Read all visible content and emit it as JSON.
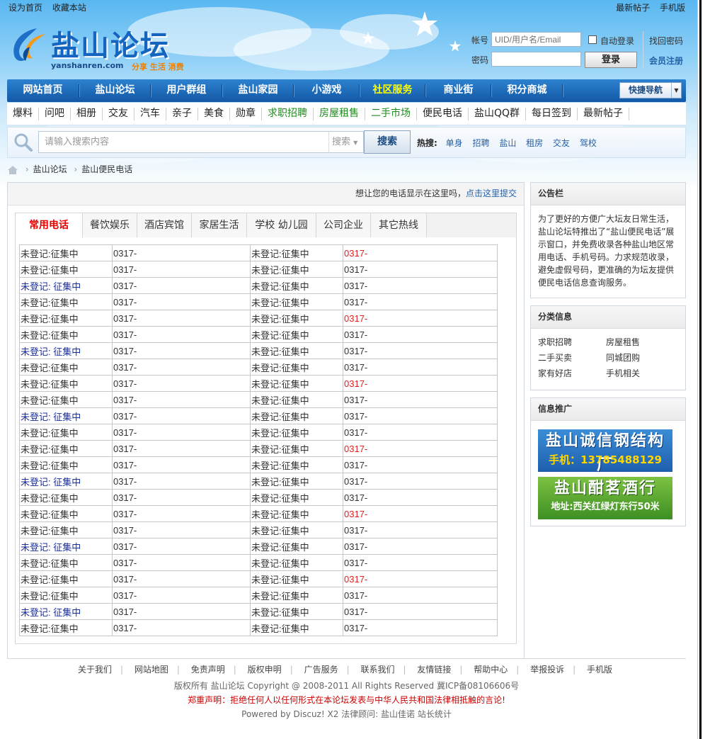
{
  "topbar": {
    "left": [
      "设为首页",
      "收藏本站"
    ],
    "right": [
      "最新帖子",
      "手机版"
    ]
  },
  "logo": {
    "title": "盐山论坛",
    "site": "yanshanren.com",
    "slogan": "分享 生活 消费"
  },
  "login": {
    "account_label": "帐号",
    "account_placeholder": "UID/用户名/Email",
    "password_label": "密码",
    "auto_login": "自动登录",
    "login_button": "登录",
    "find_password": "找回密码",
    "register": "会员注册"
  },
  "nav": {
    "items": [
      "网站首页",
      "盐山论坛",
      "用户群组",
      "盐山家园",
      "小游戏",
      "社区服务",
      "商业街",
      "积分商城"
    ],
    "active_index": 5,
    "quick": "快捷导航",
    "active_color": "#ffff00"
  },
  "subnav": {
    "items": [
      "爆料",
      "问吧",
      "相册",
      "交友",
      "汽车",
      "亲子",
      "美食",
      "勋章",
      "求职招聘",
      "房屋租售",
      "二手市场",
      "便民电话",
      "盐山QQ群",
      "每日签到",
      "最新帖子"
    ],
    "green": [
      "求职招聘",
      "房屋租售",
      "二手市场"
    ]
  },
  "search": {
    "placeholder": "请输入搜索内容",
    "select": "搜索",
    "button": "搜索",
    "hot_label": "热搜:",
    "hot": [
      "单身",
      "招聘",
      "盐山",
      "租房",
      "交友",
      "驾校"
    ]
  },
  "breadcrumb": [
    "盐山论坛",
    "盐山便民电话"
  ],
  "main": {
    "tip_text": "想让您的电话显示在这里吗，",
    "tip_link": "点击这里提交",
    "tabs": [
      "常用电话",
      "餐饮娱乐",
      "酒店宾馆",
      "家居生活",
      "学校 幼儿园",
      "公司企业",
      "其它热线"
    ],
    "active_tab": 0
  },
  "directory": {
    "rows": [
      [
        "未登记:征集中",
        "0317-",
        "未登记:征集中",
        "0317-",
        "n",
        "r"
      ],
      [
        "未登记:征集中",
        "0317-",
        "未登记:征集中",
        "0317-",
        "n",
        "n"
      ],
      [
        "未登记: 征集中",
        "0317-",
        "未登记:征集中",
        "0317-",
        "b",
        "n"
      ],
      [
        "未登记:征集中",
        "0317-",
        "未登记:征集中",
        "0317-",
        "n",
        "n"
      ],
      [
        "未登记:征集中",
        "0317-",
        "未登记:征集中",
        "0317-",
        "n",
        "r"
      ],
      [
        "未登记:征集中",
        "0317-",
        "未登记:征集中",
        "0317-",
        "n",
        "n"
      ],
      [
        "未登记: 征集中",
        "0317-",
        "未登记:征集中",
        "0317-",
        "b",
        "n"
      ],
      [
        "未登记:征集中",
        "0317-",
        "未登记:征集中",
        "0317-",
        "n",
        "n"
      ],
      [
        "未登记:征集中",
        "0317-",
        "未登记:征集中",
        "0317-",
        "n",
        "r"
      ],
      [
        "未登记:征集中",
        "0317-",
        "未登记:征集中",
        "0317-",
        "n",
        "n"
      ],
      [
        "未登记: 征集中",
        "0317-",
        "未登记:征集中",
        "0317-",
        "b",
        "n"
      ],
      [
        "未登记:征集中",
        "0317-",
        "未登记:征集中",
        "0317-",
        "n",
        "n"
      ],
      [
        "未登记:征集中",
        "0317-",
        "未登记:征集中",
        "0317-",
        "n",
        "r"
      ],
      [
        "未登记:征集中",
        "0317-",
        "未登记:征集中",
        "0317-",
        "n",
        "n"
      ],
      [
        "未登记: 征集中",
        "0317-",
        "未登记:征集中",
        "0317-",
        "b",
        "n"
      ],
      [
        "未登记:征集中",
        "0317-",
        "未登记:征集中",
        "0317-",
        "n",
        "n"
      ],
      [
        "未登记:征集中",
        "0317-",
        "未登记:征集中",
        "0317-",
        "n",
        "r"
      ],
      [
        "未登记:征集中",
        "0317-",
        "未登记:征集中",
        "0317-",
        "n",
        "n"
      ],
      [
        "未登记: 征集中",
        "0317-",
        "未登记:征集中",
        "0317-",
        "b",
        "n"
      ],
      [
        "未登记:征集中",
        "0317-",
        "未登记:征集中",
        "0317-",
        "n",
        "n"
      ],
      [
        "未登记:征集中",
        "0317-",
        "未登记:征集中",
        "0317-",
        "n",
        "r"
      ],
      [
        "未登记:征集中",
        "0317-",
        "未登记:征集中",
        "0317-",
        "n",
        "n"
      ],
      [
        "未登记: 征集中",
        "0317-",
        "未登记:征集中",
        "0317-",
        "b",
        "n"
      ],
      [
        "未登记:征集中",
        "0317-",
        "未登记:征集中",
        "0317-",
        "n",
        "n"
      ]
    ]
  },
  "sidebar": {
    "notice_title": "公告栏",
    "notice_text": "为了更好的方便广大坛友日常生活，盐山论坛特推出了“盐山便民电话”展示窗口，并免费收录各种盐山地区常用电话、手机号码。力求规范收录，避免虚假号码，更准确的为坛友提供便民电话信息查询服务。",
    "category_title": "分类信息",
    "categories": [
      [
        "求职招聘",
        "房屋租售"
      ],
      [
        "二手买卖",
        "同城团购"
      ],
      [
        "家有好店",
        "手机相关"
      ]
    ],
    "promo_title": "信息推广",
    "ads": [
      {
        "line1": "盐山诚信钢结构厂",
        "line2": "手机：13785488129"
      },
      {
        "line1": "盐山酣茗酒行",
        "line2": "地址:西关红绿灯东行50米"
      }
    ]
  },
  "footer": {
    "links": [
      "关于我们",
      "网站地图",
      "免责声明",
      "版权申明",
      "广告服务",
      "联系我们",
      "友情链接",
      "帮助中心",
      "举报投诉",
      "手机版"
    ],
    "copyright": "版权所有  盐山论坛  Copyright @ 2008-2011 All Rights Reserved 冀ICP备08106606号",
    "warning": "郑重声明：拒绝任何人以任何形式在本论坛发表与中华人民共和国法律相抵触的言论!",
    "powered": "Powered by Discuz! X2  法律顾问: 盐山佳诺  站长统计"
  }
}
